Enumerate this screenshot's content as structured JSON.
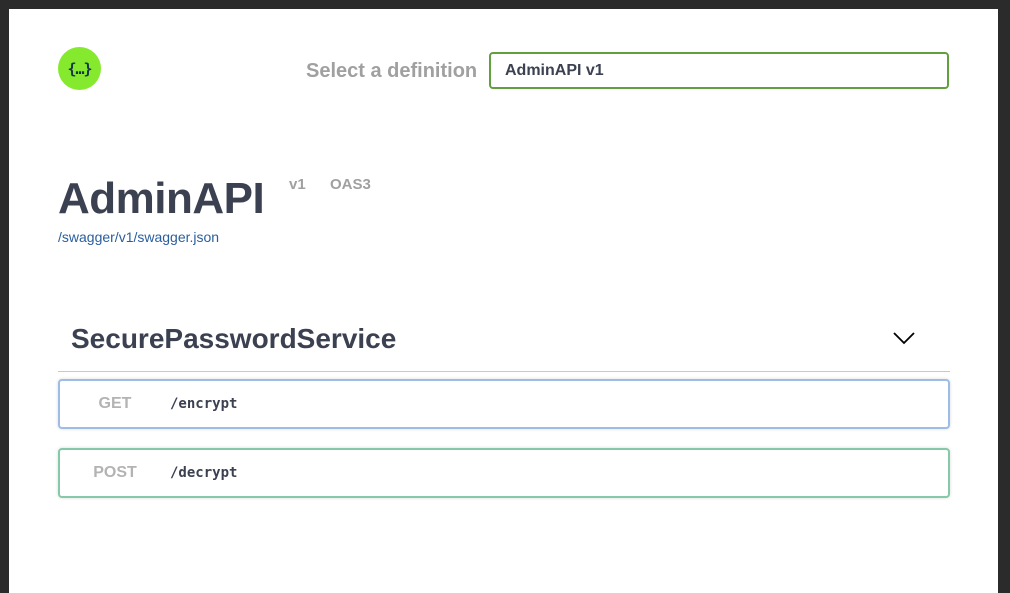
{
  "topbar": {
    "logo_glyph": "{…}",
    "select_label": "Select a definition",
    "select_value": "AdminAPI v1"
  },
  "info": {
    "title": "AdminAPI",
    "version": "v1",
    "spec_badge": "OAS3",
    "spec_url": "/swagger/v1/swagger.json"
  },
  "tag": {
    "name": "SecurePasswordService"
  },
  "operations": [
    {
      "method": "GET",
      "path": "/encrypt"
    },
    {
      "method": "POST",
      "path": "/decrypt"
    }
  ],
  "colors": {
    "accent_green": "#85ea2d",
    "select_border": "#62a03f",
    "get_border": "#9ebde6",
    "post_border": "#84c9a8",
    "text_dark": "#3b4151"
  },
  "icons": {
    "logo": "swagger-logo-icon",
    "expand": "chevron-down-icon"
  }
}
